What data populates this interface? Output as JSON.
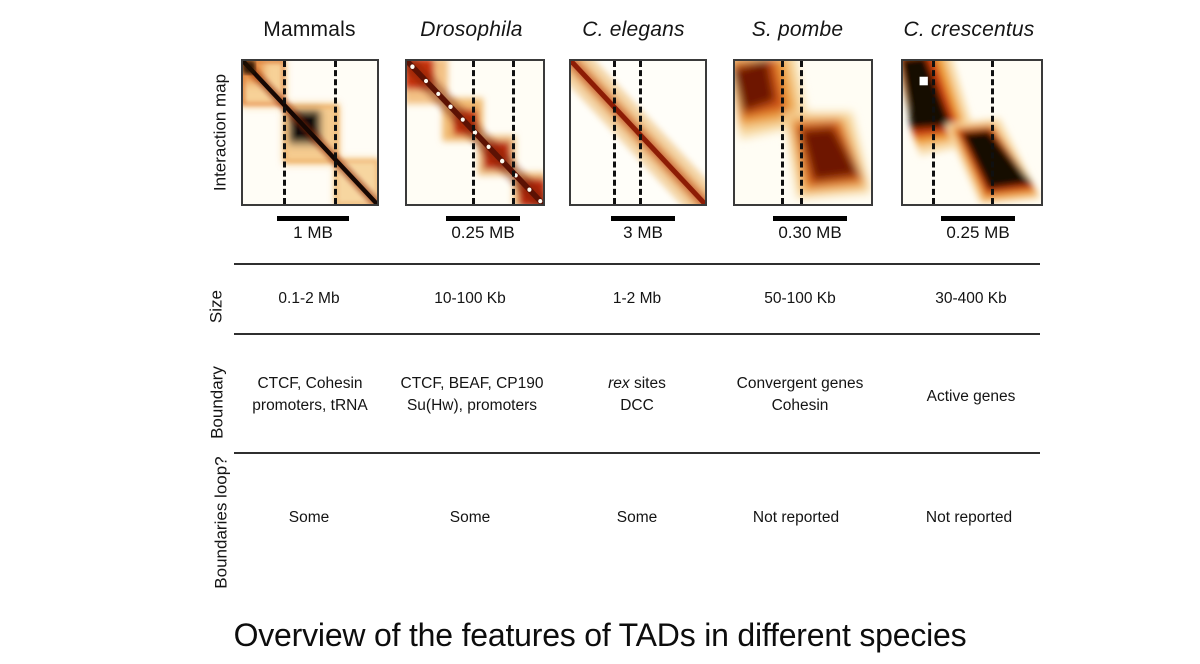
{
  "caption": "Overview of the features of TADs in different species",
  "columns": [
    {
      "name": "Mammals",
      "italic": false
    },
    {
      "name": "Drosophila",
      "italic": true
    },
    {
      "name": "C. elegans",
      "italic": true
    },
    {
      "name": "S. pombe",
      "italic": true
    },
    {
      "name": "C. crescentus",
      "italic": true
    }
  ],
  "rows": [
    {
      "label": "Interaction map"
    },
    {
      "label": "Size"
    },
    {
      "label": "Boundary"
    },
    {
      "label": "Boundaries\nloop?"
    }
  ],
  "scalebars": [
    {
      "label": "1 MB"
    },
    {
      "label": "0.25 MB"
    },
    {
      "label": "3 MB"
    },
    {
      "label": "0.30 MB"
    },
    {
      "label": "0.25 MB"
    }
  ],
  "size_row": [
    "0.1-2 Mb",
    "10-100 Kb",
    "1-2 Mb",
    "50-100 Kb",
    "30-400 Kb"
  ],
  "boundary_row": [
    "CTCF, Cohesin\npromoters, tRNA",
    "CTCF, BEAF, CP190\nSu(Hw), promoters",
    "rex sites\nDCC",
    "Convergent genes\nCohesin",
    "Active genes"
  ],
  "boundary_row_italic_prefix": [
    "",
    "",
    "rex",
    "",
    ""
  ],
  "loop_row": [
    "Some",
    "Some",
    "Some",
    "Not reported",
    "Not reported"
  ],
  "colors": {
    "heat_low": "#fffdf5",
    "heat_mid": "#f0b14a",
    "heat_high": "#d2341a",
    "heat_max": "#7a1205",
    "heat_black": "#140603",
    "rule": "#2f2f2f",
    "text": "#141414",
    "background": "#ffffff"
  },
  "chart_data": {
    "type": "heatmap",
    "title": "Overview of the features of TADs in different species",
    "panels": [
      {
        "species": "Mammals",
        "scale": "1 MB",
        "boundaries_x": [
          0.32,
          0.7
        ]
      },
      {
        "species": "Drosophila",
        "scale": "0.25 MB",
        "boundaries_x": [
          0.5,
          0.77
        ]
      },
      {
        "species": "C. elegans",
        "scale": "3 MB",
        "boundaries_x": [
          0.33,
          0.52
        ]
      },
      {
        "species": "S. pombe",
        "scale": "0.30 MB",
        "boundaries_x": [
          0.35,
          0.48
        ]
      },
      {
        "species": "C. crescentus",
        "scale": "0.25 MB",
        "boundaries_x": [
          0.22,
          0.66
        ]
      }
    ]
  }
}
